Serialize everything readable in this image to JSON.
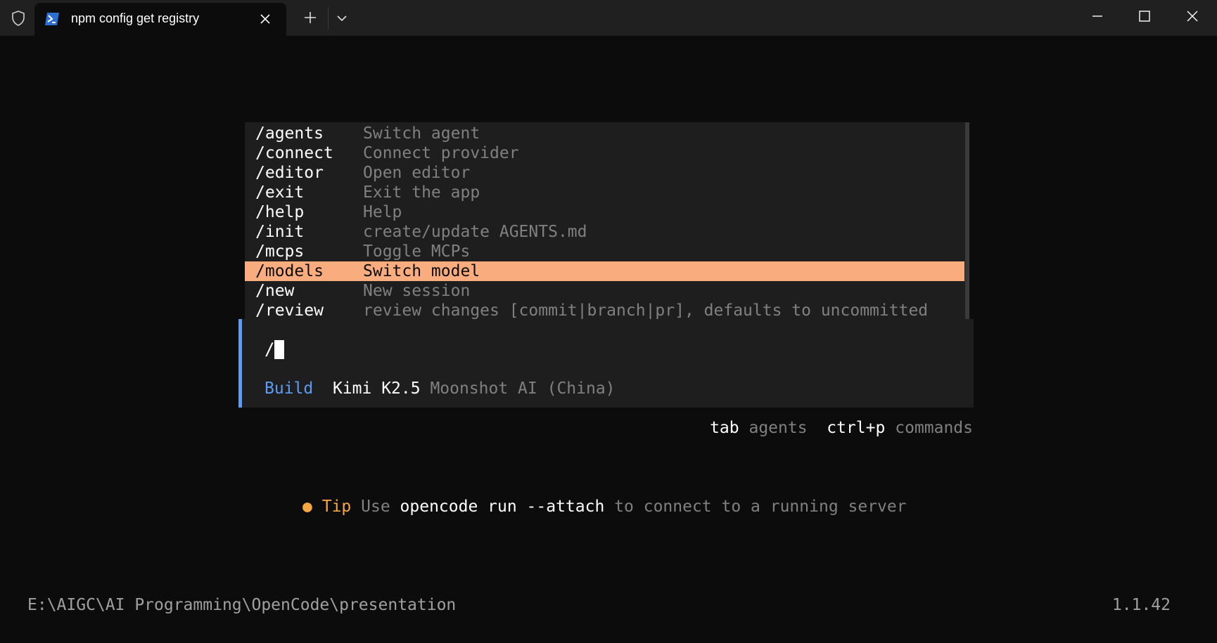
{
  "titlebar": {
    "tab_title": "npm config get registry",
    "icons": [
      "shield-icon",
      "powershell-icon",
      "close-icon",
      "plus-icon",
      "chevron-down-icon",
      "minimize-icon",
      "maximize-icon",
      "close-icon"
    ]
  },
  "commands": [
    {
      "name": "/agents",
      "desc": "Switch agent"
    },
    {
      "name": "/connect",
      "desc": "Connect provider"
    },
    {
      "name": "/editor",
      "desc": "Open editor"
    },
    {
      "name": "/exit",
      "desc": "Exit the app"
    },
    {
      "name": "/help",
      "desc": "Help"
    },
    {
      "name": "/init",
      "desc": "create/update AGENTS.md"
    },
    {
      "name": "/mcps",
      "desc": "Toggle MCPs"
    },
    {
      "name": "/models",
      "desc": "Switch model",
      "selected": true
    },
    {
      "name": "/new",
      "desc": "New session"
    },
    {
      "name": "/review",
      "desc": "review changes [commit|branch|pr], defaults to uncommitted"
    }
  ],
  "prompt": {
    "input": "/",
    "agent": "Build",
    "model": "Kimi K2.5",
    "provider": "Moonshot AI (China)"
  },
  "hints": {
    "key1": "tab",
    "val1": "agents",
    "key2": "ctrl+p",
    "val2": "commands"
  },
  "tip": {
    "bullet": "●",
    "label": "Tip",
    "pre": "Use",
    "code": "opencode run --attach",
    "post": "to connect to a running server"
  },
  "footer": {
    "cwd": "E:\\AIGC\\AI Programming\\OpenCode\\presentation",
    "version": "1.1.42"
  },
  "colors": {
    "background": "#0c0c0c",
    "panel": "#1e1e1e",
    "selection": "#f9ad7e",
    "accent_blue": "#5c9cf5",
    "tip_orange": "#f5a742"
  }
}
